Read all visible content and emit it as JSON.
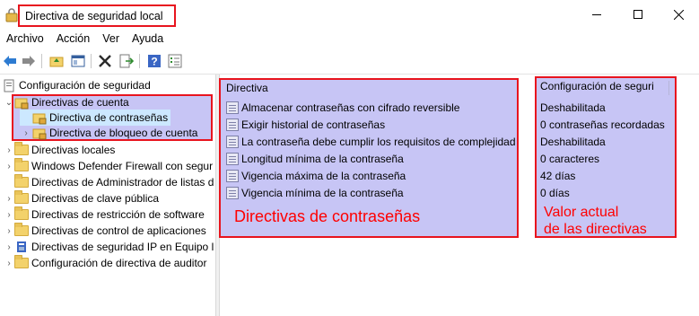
{
  "window": {
    "title": "Directiva de seguridad local",
    "icon": "security-policy-icon"
  },
  "menu": [
    "Archivo",
    "Acción",
    "Ver",
    "Ayuda"
  ],
  "toolbar": {
    "icons": [
      "back-arrow-icon",
      "forward-arrow-icon",
      "up-folder-icon",
      "show-hide-tree-icon",
      "delete-icon",
      "export-list-icon",
      "help-icon",
      "properties-icon"
    ]
  },
  "tree": {
    "root": "Configuración de seguridad",
    "items": [
      "Directivas de cuenta",
      "Directiva de contraseñas",
      "Directiva de bloqueo de cuenta",
      "Directivas locales",
      "Windows Defender Firewall con segur",
      "Directivas de Administrador de listas d",
      "Directivas de clave pública",
      "Directivas de restricción de software",
      "Directivas de control de aplicaciones",
      "Directivas de seguridad IP en Equipo l",
      "Configuración de directiva de auditor"
    ]
  },
  "list": {
    "col1": "Directiva",
    "col2": "Configuración de seguri",
    "policies": [
      "Almacenar contraseñas con cifrado reversible",
      "Exigir historial de contraseñas",
      "La contraseña debe cumplir los requisitos de complejidad",
      "Longitud mínima de la contraseña",
      "Vigencia máxima de la contraseña",
      "Vigencia mínima de la contraseña"
    ],
    "values": [
      "Deshabilitada",
      "0 contraseñas recordadas",
      "Deshabilitada",
      "0 caracteres",
      "42 días",
      "0 días"
    ]
  },
  "annotations": {
    "policies_label": "Directivas de contraseñas",
    "values_line1": "Valor actual",
    "values_line2": "de las directivas",
    "color": "#ff0000"
  },
  "colors": {
    "highlight": "#c7c5f5",
    "outline": "#e8141e",
    "selection": "#cce8ff"
  }
}
